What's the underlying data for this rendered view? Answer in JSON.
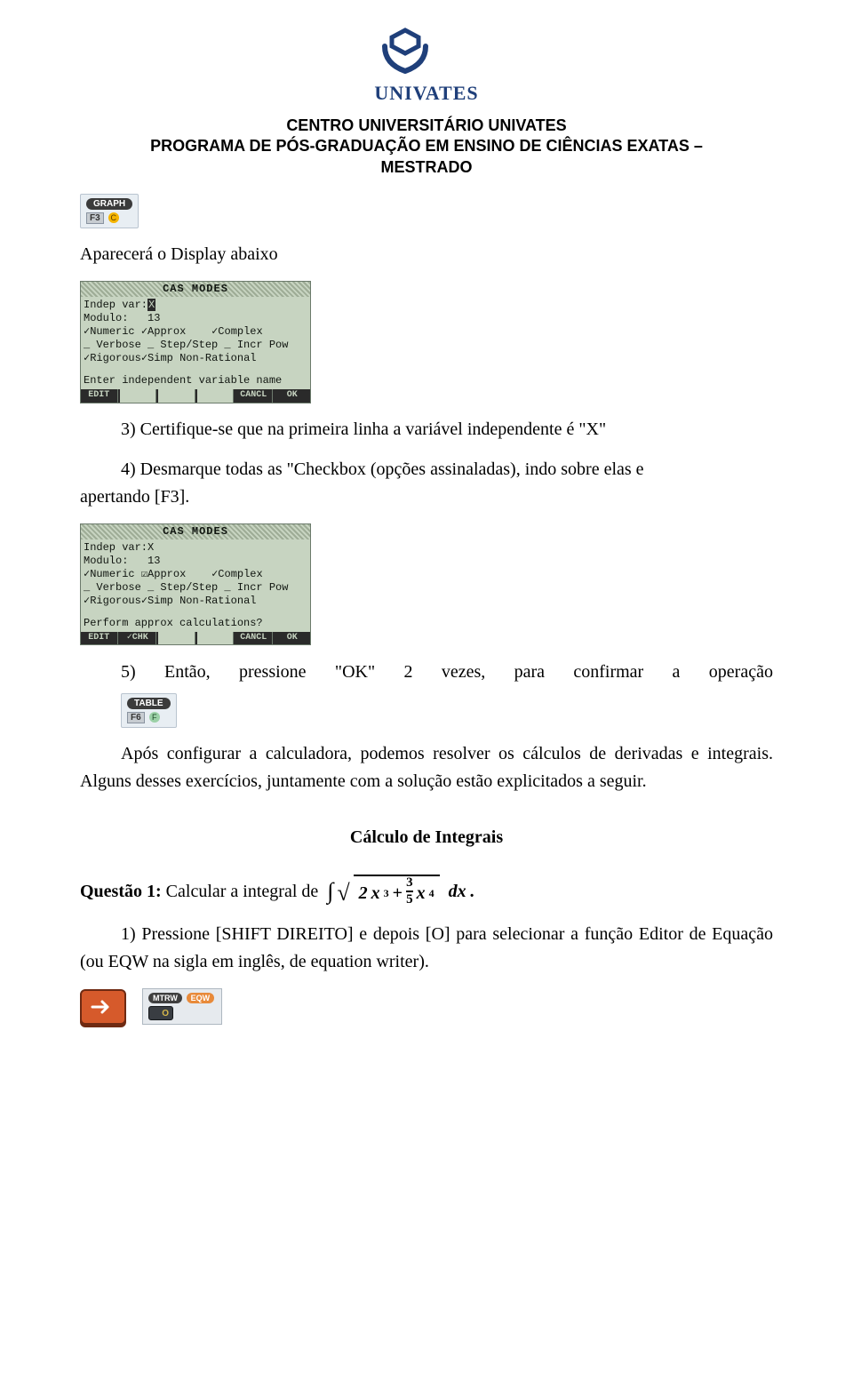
{
  "logo_text": "UNIVATES",
  "header": {
    "line1": "CENTRO UNIVERSITÁRIO UNIVATES",
    "line2": "PROGRAMA DE PÓS-GRADUAÇÃO EM ENSINO DE CIÊNCIAS EXATAS –",
    "line3": "MESTRADO"
  },
  "graph_key": {
    "label": "GRAPH",
    "fn": "F3",
    "badge": "C"
  },
  "text1": "Aparecerá o Display abaixo",
  "cas1": {
    "title": "CAS MODES",
    "rows": [
      "Indep var:X",
      "Modulo:   13",
      "✓Numeric ✓Approx    ✓Complex",
      "_ Verbose _ Step/Step _ Incr Pow",
      "✓Rigorous✓Simp Non-Rational"
    ],
    "status": "Enter independent variable name",
    "softkeys": [
      "EDIT",
      "",
      "",
      "",
      "CANCL",
      "OK"
    ],
    "independentHighlighted": true
  },
  "step3": "3) Certifique-se que na primeira linha a variável independente é \"X\"",
  "step4a": "4) Desmarque todas as \"Checkbox (opções assinaladas), indo sobre elas e",
  "step4b": "apertando [F3].",
  "cas2": {
    "title": "CAS MODES",
    "rows": [
      "Indep var:X",
      "Modulo:   13",
      "✓Numeric ☑Approx    ✓Complex",
      "_ Verbose _ Step/Step _ Incr Pow",
      "✓Rigorous✓Simp Non-Rational"
    ],
    "status": "Perform approx calculations?",
    "softkeys": [
      "EDIT",
      "✓CHK",
      "",
      "",
      "CANCL",
      "OK"
    ]
  },
  "step5": {
    "a": "5)",
    "b": "Então,",
    "c": "pressione",
    "d": "\"OK\"",
    "e": "2",
    "f": "vezes,",
    "g": "para",
    "h": "confirmar",
    "i": "a",
    "j": "operação"
  },
  "table_key": {
    "label": "TABLE",
    "fn": "F6",
    "badge": "F"
  },
  "paragraph": "Após configurar a calculadora, podemos resolver os cálculos de derivadas e integrais. Alguns desses exercícios, juntamente com a solução estão explicitados a seguir.",
  "section_title": "Cálculo de Integrais",
  "question1_label": "Questão 1:",
  "question1_text": "Calcular a integral de",
  "math": {
    "int": "∫",
    "sqrt": "√",
    "term1_coef": "2",
    "term1_var": "x",
    "term1_pow": "3",
    "plus": "+",
    "frac_num": "3",
    "frac_den": "5",
    "term2_var": "x",
    "term2_pow": "4",
    "dx": "dx",
    "period": "."
  },
  "step1p": "1) Pressione [SHIFT DIREITO] e depois [O] para selecionar a função Editor de Equação (ou EQW na sigla em inglês, de equation writer).",
  "eqw": {
    "pill1": "MTRW",
    "pill2": "EQW",
    "key_char": "O"
  }
}
